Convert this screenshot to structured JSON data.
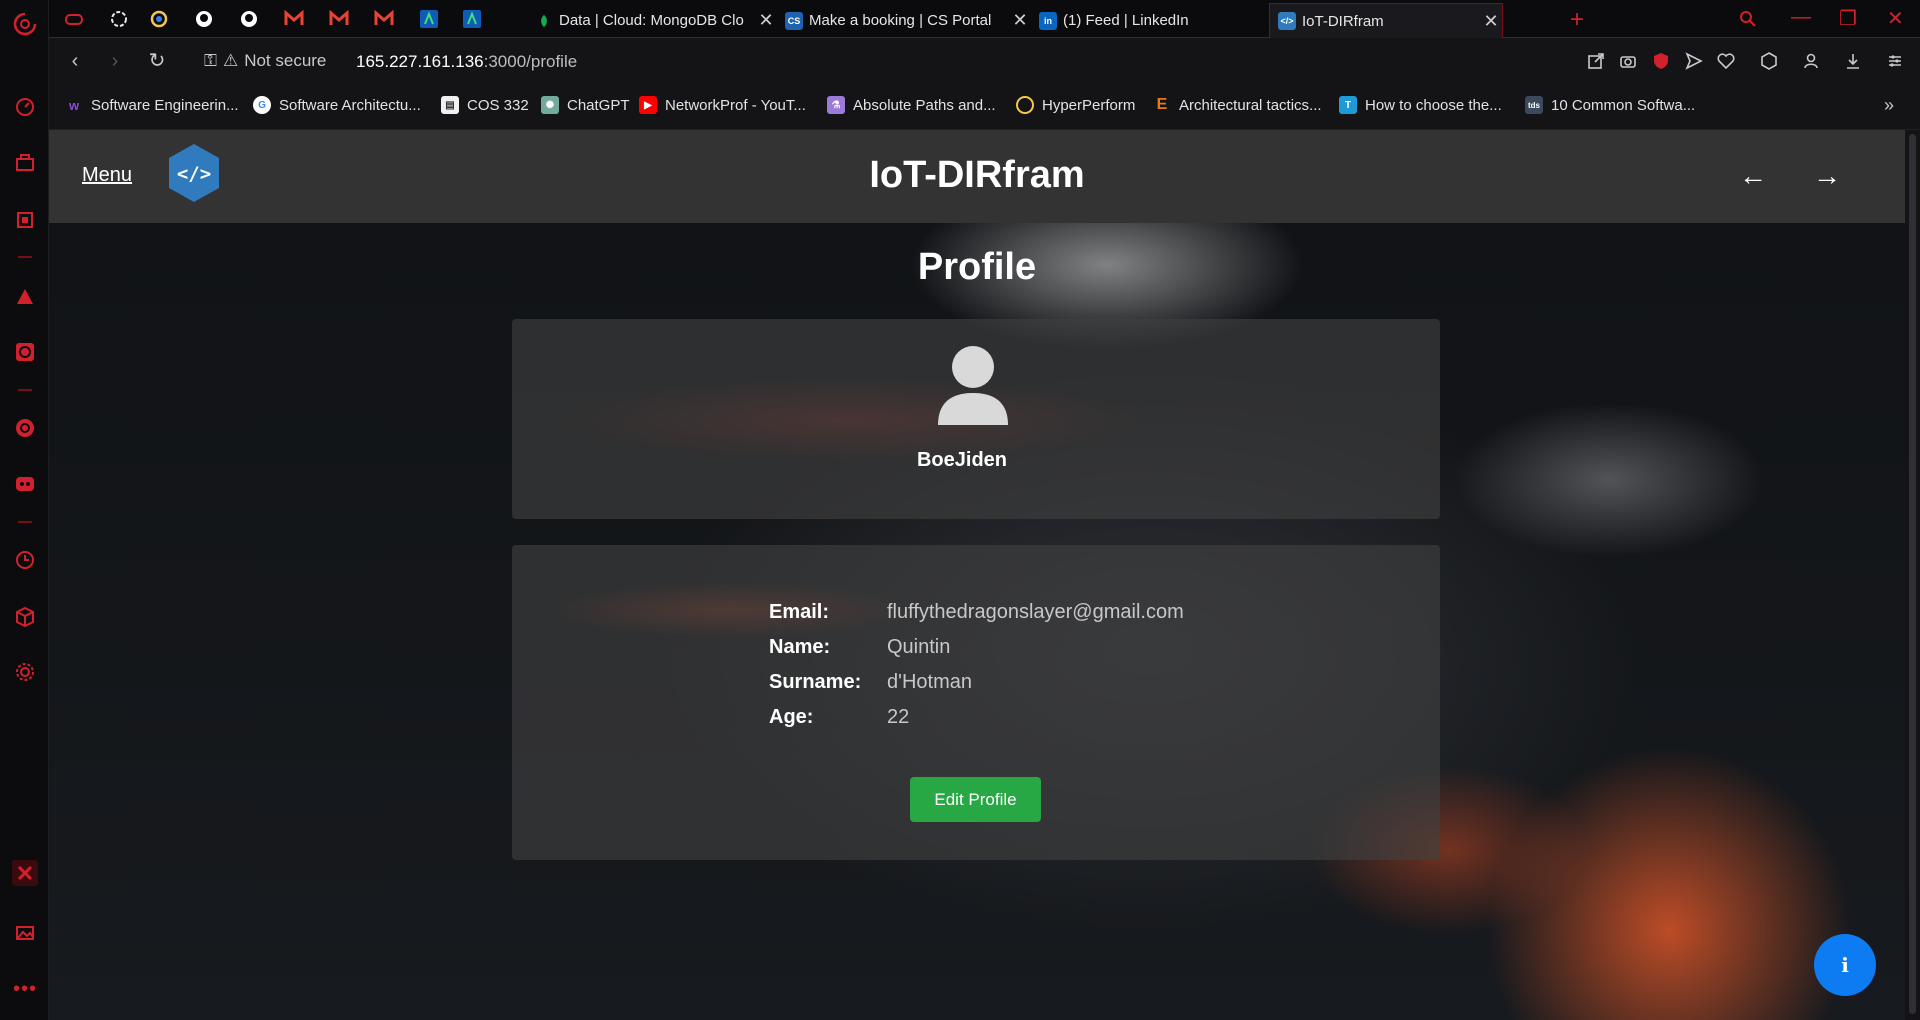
{
  "browser": {
    "tabs": [
      {
        "title": "Data | Cloud: MongoDB Clo",
        "active": false
      },
      {
        "title": "Make a booking | CS Portal",
        "active": false
      },
      {
        "title": "(1) Feed | LinkedIn",
        "active": false
      },
      {
        "title": "IoT-DIRfram",
        "active": true
      }
    ],
    "pinned_tabs": [
      "gamepad-icon",
      "chatgpt-icon",
      "hyperperform-icon",
      "github-icon",
      "github-icon",
      "gmail-icon",
      "gmail-icon",
      "gmail-icon",
      "arrow-app-icon",
      "arrow-app-icon"
    ],
    "new_tab": "+",
    "address": {
      "security_label": "Not secure",
      "host": "165.227.161.136",
      "rest": ":3000/profile"
    },
    "bookmarks": [
      {
        "label": "Software Engineerin...",
        "icon": "purple-w-icon"
      },
      {
        "label": "Software Architectu...",
        "icon": "google-icon"
      },
      {
        "label": "COS 332",
        "icon": "document-icon"
      },
      {
        "label": "ChatGPT",
        "icon": "chatgpt-icon"
      },
      {
        "label": "NetworkProf - YouT...",
        "icon": "youtube-icon"
      },
      {
        "label": "Absolute Paths and...",
        "icon": "flask-icon"
      },
      {
        "label": "HyperPerform",
        "icon": "hyperperform-icon"
      },
      {
        "label": "Architectural tactics...",
        "icon": "e-icon"
      },
      {
        "label": "How to choose the...",
        "icon": "tc-icon"
      },
      {
        "label": "10 Common Softwa...",
        "icon": "tds-icon"
      }
    ],
    "bookmarks_overflow": "»"
  },
  "app": {
    "menu_label": "Menu",
    "title": "IoT-DIRfram",
    "back_arrow": "←",
    "forward_arrow": "→",
    "logo_glyph": "</>",
    "page_heading": "Profile",
    "username": "BoeJiden",
    "fields": [
      {
        "label": "Email:",
        "value": "fluffythedragonslayer@gmail.com"
      },
      {
        "label": "Name:",
        "value": "Quintin"
      },
      {
        "label": "Surname:",
        "value": "d'Hotman"
      },
      {
        "label": "Age:",
        "value": "22"
      }
    ],
    "edit_button": "Edit Profile",
    "info_button": "i"
  },
  "colors": {
    "accent_red": "#d3202d",
    "header_bg": "#333333",
    "edit_button": "#28a745",
    "info_button": "#0d7cf2",
    "logo_blue": "#2f7bbd"
  }
}
